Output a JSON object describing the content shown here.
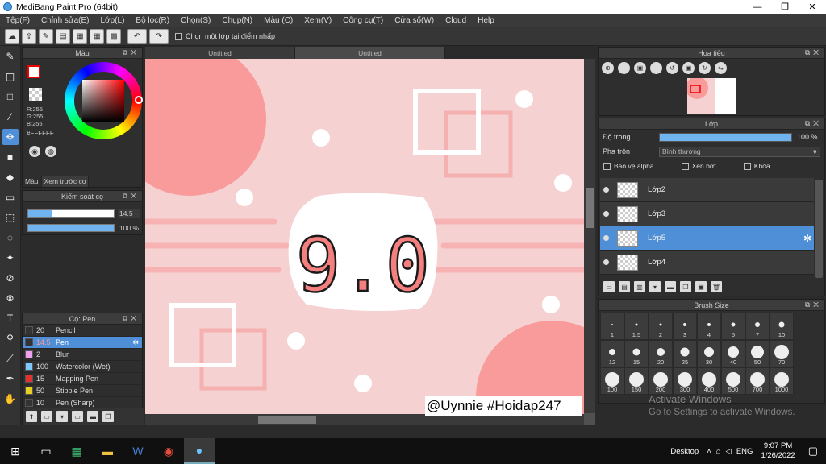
{
  "window": {
    "title": "MediBang Paint Pro (64bit)",
    "min": "—",
    "max": "❐",
    "close": "✕"
  },
  "menu": [
    "Tệp(F)",
    "Chỉnh sửa(E)",
    "Lớp(L)",
    "Bộ lọc(R)",
    "Chọn(S)",
    "Chụp(N)",
    "Màu (C)",
    "Xem(V)",
    "Công cụ(T)",
    "Cửa số(W)",
    "Cloud",
    "Help"
  ],
  "toolbar": {
    "checkbox_label": "Chọn một lớp tại điểm nhấp"
  },
  "color_panel": {
    "title": "Màu",
    "r": "R:255",
    "g": "G:255",
    "b": "B:255",
    "hex": "#FFFFFF",
    "tabs": [
      "Màu",
      "Xem trước cọ"
    ]
  },
  "brush_control": {
    "title": "Kiểm soát cọ",
    "size": "14.5",
    "size_fill": 0.28,
    "opacity": "100 %",
    "opacity_fill": 1.0
  },
  "brush_panel": {
    "title": "Cọ: Pen",
    "items": [
      {
        "size": "20",
        "name": "Pencil",
        "color": "#333333"
      },
      {
        "size": "14.5",
        "name": "Pen",
        "color": "#333333",
        "selected": true
      },
      {
        "size": "2",
        "name": "Blur",
        "color": "#f0a0f0"
      },
      {
        "size": "100",
        "name": "Watercolor (Wet)",
        "color": "#7ec8ff"
      },
      {
        "size": "15",
        "name": "Mapping Pen",
        "color": "#e03030"
      },
      {
        "size": "50",
        "name": "Stipple Pen",
        "color": "#e8d020"
      },
      {
        "size": "10",
        "name": "Pen (Sharp)",
        "color": "#333333"
      }
    ]
  },
  "doc_tabs": [
    "Untitled",
    "Untitled"
  ],
  "canvas_text": "9.0",
  "watermark": "@Uynnie #Hoidap247",
  "navigator": {
    "title": "Hoa tiêu"
  },
  "layer_panel": {
    "title": "Lớp",
    "opacity_label": "Độ trong",
    "opacity_value": "100 %",
    "blend_label": "Pha trộn",
    "blend_value": "Bình thường",
    "protect_alpha": "Bảo vệ alpha",
    "clipping": "Xén bớt",
    "lock": "Khóa",
    "layers": [
      {
        "name": "Lớp2",
        "selected": false
      },
      {
        "name": "Lớp3",
        "selected": false
      },
      {
        "name": "Lớp5",
        "selected": true
      },
      {
        "name": "Lớp4",
        "selected": false
      }
    ]
  },
  "brush_size": {
    "title": "Brush Size",
    "sizes": [
      "1",
      "1.5",
      "2",
      "3",
      "4",
      "5",
      "7",
      "10",
      "12",
      "15",
      "20",
      "25",
      "30",
      "40",
      "50",
      "70",
      "100",
      "150",
      "200",
      "300",
      "400",
      "500",
      "700",
      "1000"
    ]
  },
  "activate": {
    "line1": "Activate Windows",
    "line2": "Go to Settings to activate Windows."
  },
  "taskbar": {
    "desktop": "Desktop",
    "lang": "ENG",
    "time": "9:07 PM",
    "date": "1/26/2022"
  }
}
